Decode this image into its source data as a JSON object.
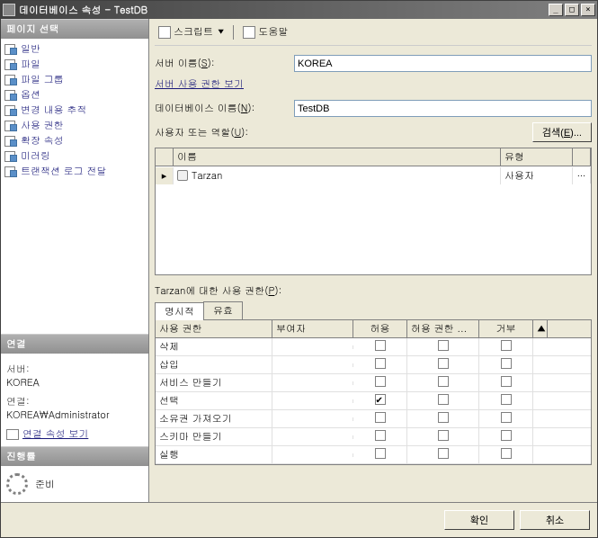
{
  "titlebar": {
    "title": "데이터베이스 속성 - TestDB"
  },
  "sidebar": {
    "pages_header": "페이지 선택",
    "pages": [
      {
        "label": "일반"
      },
      {
        "label": "파일"
      },
      {
        "label": "파일 그룹"
      },
      {
        "label": "옵션"
      },
      {
        "label": "변경 내용 추적"
      },
      {
        "label": "사용 권한",
        "selected": true
      },
      {
        "label": "확장 속성"
      },
      {
        "label": "미러링"
      },
      {
        "label": "트랜잭션 로그 전달"
      }
    ],
    "conn_header": "연결",
    "server_label": "서버:",
    "server_value": "KOREA",
    "conn_label": "연결:",
    "conn_value": "KOREA\\Administrator",
    "conn_props_link": "연결 속성 보기",
    "progress_header": "진행률",
    "progress_status": "준비"
  },
  "toolbar": {
    "script_label": "스크립트",
    "help_label": "도움말"
  },
  "main": {
    "server_name_label": "서버 이름(S):",
    "server_name_value": "KOREA",
    "server_perm_link": "서버 사용 권한 보기",
    "db_name_label": "데이터베이스 이름(N):",
    "db_name_value": "TestDB",
    "users_label": "사용자 또는 역할(U):",
    "search_btn": "검색(E)...",
    "grid": {
      "head_name": "이름",
      "head_type": "유형",
      "rows": [
        {
          "name": "Tarzan",
          "type": "사용자"
        }
      ]
    },
    "perm_for_label": "Tarzan에 대한 사용 권한(P):",
    "tabs": {
      "explicit": "명시적",
      "effective": "유효"
    },
    "perm_head": {
      "perm": "사용 권한",
      "grantor": "부여자",
      "allow": "허용",
      "withgrant": "허용 권한 ...",
      "deny": "거부"
    },
    "perms": [
      {
        "name": "삭제",
        "allow": false,
        "withgrant": false,
        "deny": false
      },
      {
        "name": "삽입",
        "allow": false,
        "withgrant": false,
        "deny": false
      },
      {
        "name": "서비스 만들기",
        "allow": false,
        "withgrant": false,
        "deny": false
      },
      {
        "name": "선택",
        "allow": true,
        "withgrant": false,
        "deny": false
      },
      {
        "name": "소유권 가져오기",
        "allow": false,
        "withgrant": false,
        "deny": false
      },
      {
        "name": "스키마 만들기",
        "allow": false,
        "withgrant": false,
        "deny": false
      },
      {
        "name": "실행",
        "allow": false,
        "withgrant": false,
        "deny": false
      }
    ]
  },
  "footer": {
    "ok": "확인",
    "cancel": "취소"
  }
}
